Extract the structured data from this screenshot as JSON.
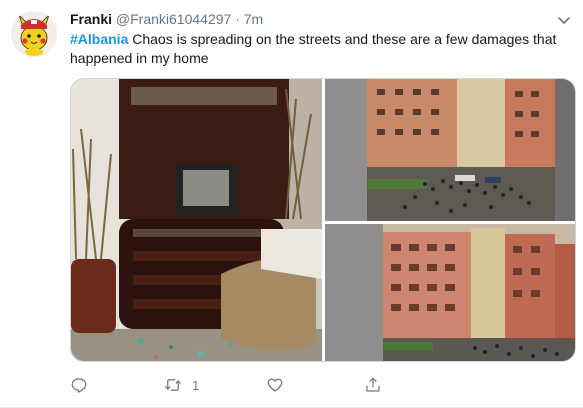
{
  "tweet": {
    "display_name": "Franki",
    "handle": "@Franki61044297",
    "separator": "·",
    "time": "7m",
    "hashtag": "#Albania",
    "body": " Chaos is spreading on the streets and these are a few damages that happened in my home",
    "more_icon": "chevron-down-icon",
    "avatar_icon": "pikachu-avatar"
  },
  "media": {
    "photos": [
      {
        "subject": "tv-stand-with-broken-glass"
      },
      {
        "subject": "crowd-in-street-between-buildings"
      },
      {
        "subject": "building-facade-and-street"
      }
    ]
  },
  "actions": {
    "reply_icon": "reply-icon",
    "retweet_icon": "retweet-icon",
    "retweet_count": "1",
    "like_icon": "heart-icon",
    "share_icon": "share-icon"
  },
  "colors": {
    "accent": "#1b95e0",
    "text": "#14171a",
    "secondary": "#657786"
  }
}
